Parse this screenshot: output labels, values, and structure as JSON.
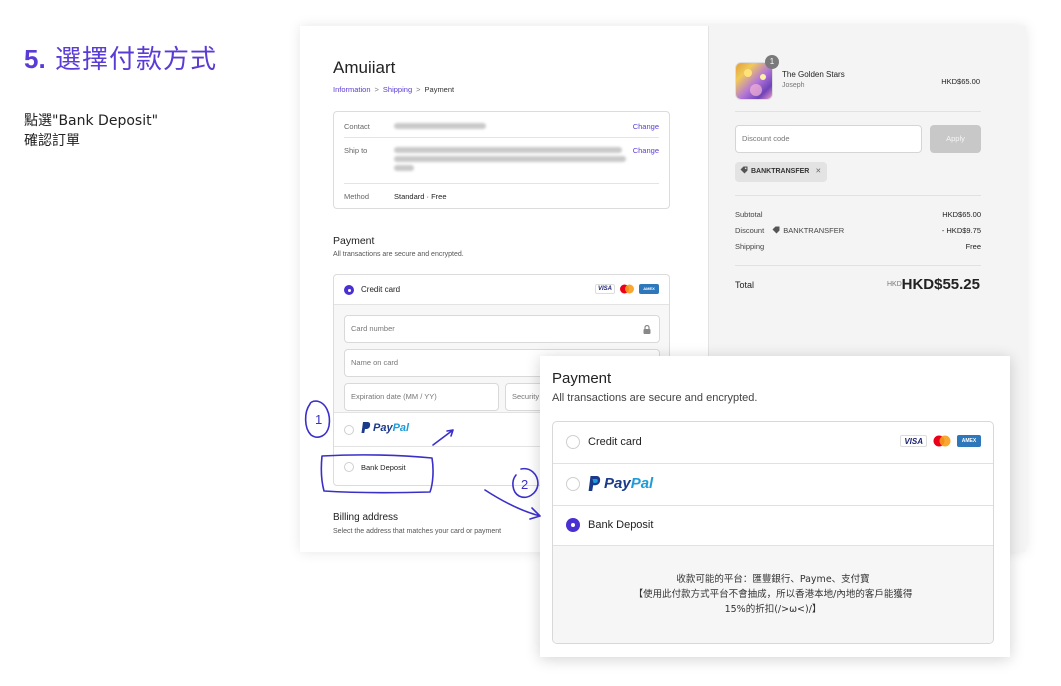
{
  "step": {
    "number": "5.",
    "title": "選擇付款方式",
    "desc_line1": "點選\"Bank Deposit\"",
    "desc_line2": "確認訂單"
  },
  "checkout": {
    "store_name": "Amuiiart",
    "breadcrumb": [
      "Information",
      ">",
      "Shipping",
      ">",
      "Payment"
    ],
    "review": {
      "contact_label": "Contact",
      "ship_label": "Ship to",
      "method_label": "Method",
      "method_value": "Standard · Free",
      "change_label": "Change"
    },
    "payment": {
      "title": "Payment",
      "subtitle": "All transactions are secure and encrypted.",
      "credit_card_label": "Credit card",
      "fields": {
        "card_number": "Card number",
        "name_on_card": "Name on card",
        "expiration": "Expiration date (MM / YY)",
        "security": "Security"
      },
      "paypal_pay": "Pay",
      "paypal_pal": "Pal",
      "bank_label": "Bank Deposit"
    },
    "billing": {
      "title": "Billing address",
      "subtitle": "Select the address that matches your card or payment"
    },
    "summary": {
      "product_qty": "1",
      "product_name": "The Golden Stars",
      "product_author": "Joseph",
      "product_price": "HKD$65.00",
      "discount_placeholder": "Discount code",
      "apply_label": "Apply",
      "tag": "BANKTRANSFER",
      "tag_remove": "✕",
      "subtotal_label": "Subtotal",
      "subtotal_value": "HKD$65.00",
      "discount_label": "Discount",
      "discount_code": "BANKTRANSFER",
      "discount_value": "- HKD$9.75",
      "shipping_label": "Shipping",
      "shipping_value": "Free",
      "total_label": "Total",
      "total_currency": "HKD",
      "total_value": "HKD$55.25"
    }
  },
  "zoom": {
    "title": "Payment",
    "subtitle": "All transactions are secure and encrypted.",
    "credit_card_label": "Credit card",
    "bank_label": "Bank Deposit",
    "visa_label": "VISA",
    "amex_label": "AMEX",
    "info_line1": "收款可能的平台：匯豐銀行、Payme、支付寶",
    "info_line2": "【使用此付款方式平台不會抽成，所以香港本地/內地的客戶能獲得",
    "info_line3": "15%的折扣(/>ω<)/】"
  },
  "annotations": {
    "one": "1",
    "two": "2"
  },
  "colors": {
    "accent": "#5b3bd6",
    "radio_selected": "#4a2fd1",
    "annotation": "#3a2fc9"
  }
}
